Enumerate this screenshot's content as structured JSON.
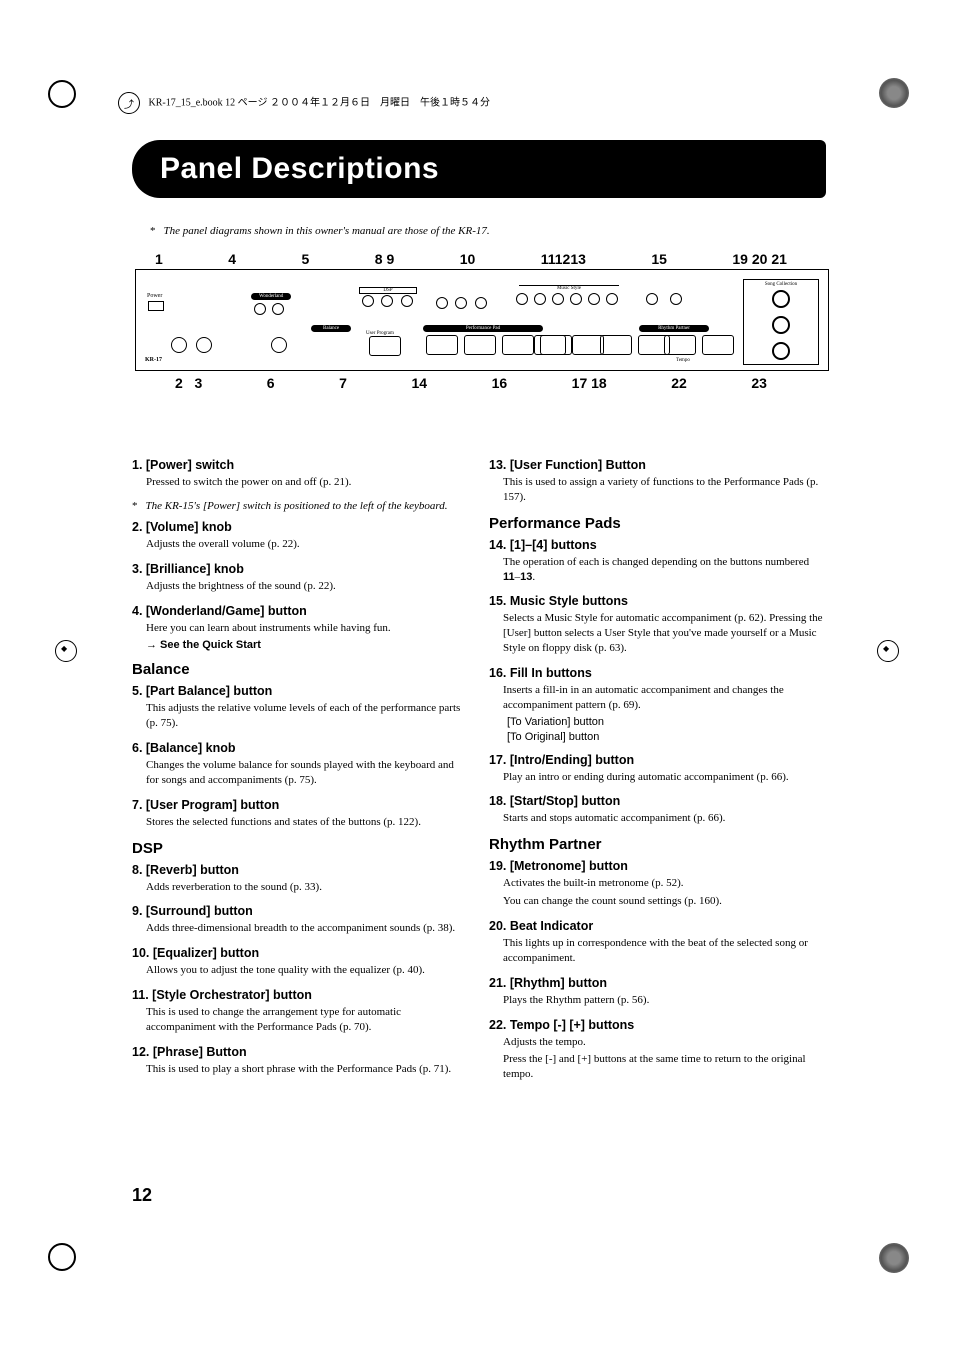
{
  "running_head": "KR-17_15_e.book  12 ページ  ２００４年１２月６日　月曜日　午後１時５４分",
  "title": "Panel Descriptions",
  "intro_note": "The panel diagrams shown in this owner's manual are those of the KR-17.",
  "diagram_numbers_top": [
    "1",
    "4",
    "5",
    "8",
    "9",
    "10",
    "11",
    "12",
    "13",
    "15",
    "19",
    "20",
    "21"
  ],
  "diagram_numbers_bottom": [
    "2",
    "3",
    "6",
    "7",
    "14",
    "16",
    "17",
    "18",
    "22",
    "23"
  ],
  "diagram_labels": {
    "power": "Power",
    "kr17": "KR-17",
    "song_collection": "Song Collection",
    "music_style": "Music Style",
    "dsp": "DSP",
    "balance": "Balance",
    "performance_pad": "Performance Pad",
    "rhythm_partner": "Rhythm Partner",
    "user_program": "User Program",
    "tempo": "Tempo"
  },
  "left": {
    "items_a": [
      {
        "t": "1.  [Power] switch",
        "d": "Pressed to switch the power on and off (p. 21)."
      },
      {
        "note": "The KR-15's [Power] switch is positioned to the left of the keyboard."
      },
      {
        "t": "2.  [Volume] knob",
        "d": "Adjusts the overall volume (p. 22)."
      },
      {
        "t": "3.  [Brilliance] knob",
        "d": "Adjusts the brightness of the sound (p. 22)."
      },
      {
        "t": "4.  [Wonderland/Game] button",
        "d": "Here you can learn about instruments while having fun.",
        "see": "→ See the Quick Start"
      }
    ],
    "section_balance": "Balance",
    "items_b": [
      {
        "t": "5.  [Part Balance] button",
        "d": "This adjusts the relative volume levels of each of the performance parts (p. 75)."
      },
      {
        "t": "6.  [Balance] knob",
        "d": "Changes the volume balance for sounds played with the keyboard and for songs and accompaniments (p. 75)."
      },
      {
        "t": "7.  [User Program] button",
        "d": "Stores the selected functions and states of the buttons (p. 122)."
      }
    ],
    "section_dsp": "DSP",
    "items_c": [
      {
        "t": "8.  [Reverb] button",
        "d": "Adds reverberation to the sound (p. 33)."
      },
      {
        "t": "9.  [Surround] button",
        "d": "Adds three-dimensional breadth to the accompaniment sounds (p. 38)."
      },
      {
        "t": "10. [Equalizer] button",
        "d": "Allows you to adjust the tone quality with the equalizer (p. 40)."
      },
      {
        "t": "11. [Style Orchestrator] button",
        "d": "This is used to change the arrangement type for automatic accompaniment with the Performance Pads (p. 70)."
      },
      {
        "t": "12. [Phrase] Button",
        "d": "This is used to play a short phrase with the Performance Pads (p. 71)."
      }
    ]
  },
  "right": {
    "items_a": [
      {
        "t": "13. [User Function] Button",
        "d": "This is used to assign a variety of functions to the Performance Pads (p. 157)."
      }
    ],
    "section_perf": "Performance Pads",
    "items_b": [
      {
        "t": "14. [1]–[4] buttons",
        "d_pre": "The operation of each is changed depending on the buttons numbered ",
        "b1": "11",
        "dash": "–",
        "b2": "13",
        "d_post": "."
      },
      {
        "t": "15. Music Style buttons",
        "d": "Selects a Music Style for automatic accompaniment (p. 62). Pressing the [User] button selects a User Style that you've made yourself or a Music Style on floppy disk (p. 63)."
      },
      {
        "t": "16. Fill In buttons",
        "d": "Inserts a fill-in in an automatic accompaniment and changes the accompaniment pattern (p. 69).",
        "sub1": "[To Variation] button",
        "sub2": "[To Original] button"
      },
      {
        "t": "17. [Intro/Ending] button",
        "d": "Play an intro or ending during automatic accompaniment (p. 66)."
      },
      {
        "t": "18. [Start/Stop] button",
        "d": "Starts and stops automatic accompaniment (p. 66)."
      }
    ],
    "section_rhythm": "Rhythm Partner",
    "items_c": [
      {
        "t": "19. [Metronome] button",
        "d": "Activates the built-in metronome (p. 52).",
        "d2": "You can change the count sound settings (p. 160)."
      },
      {
        "t": "20. Beat Indicator",
        "d": "This lights up in correspondence with the beat of the selected song or accompaniment."
      },
      {
        "t": "21. [Rhythm] button",
        "d": "Plays the Rhythm pattern (p. 56)."
      },
      {
        "t": "22. Tempo [-] [+] buttons",
        "d": "Adjusts the tempo.",
        "d2": "Press the [-] and [+] buttons at the same time to return to the original tempo."
      }
    ]
  },
  "page_number": "12"
}
